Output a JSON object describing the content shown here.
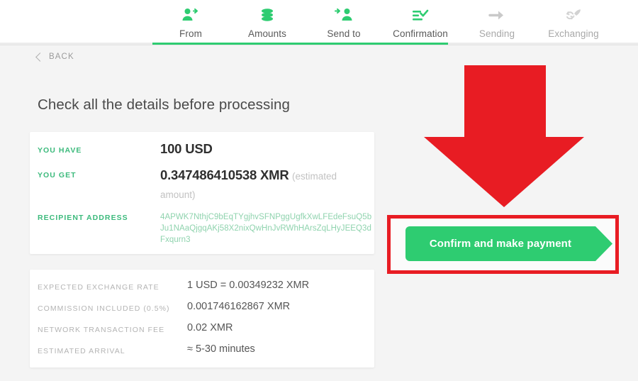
{
  "nav": {
    "steps": [
      {
        "label": "From",
        "icon": "person-arrow-icon",
        "state": "done"
      },
      {
        "label": "Amounts",
        "icon": "coins-stack-icon",
        "state": "done"
      },
      {
        "label": "Send to",
        "icon": "arrow-person-icon",
        "state": "done"
      },
      {
        "label": "Confirmation",
        "icon": "checklist-check-icon",
        "state": "active"
      },
      {
        "label": "Sending",
        "icon": "arrow-right-icon",
        "state": "pending"
      },
      {
        "label": "Exchanging",
        "icon": "exchange-rocket-icon",
        "state": "pending"
      }
    ],
    "progress_percent": 62
  },
  "back": {
    "label": "BACK",
    "icon": "chevron-left-icon"
  },
  "page": {
    "title": "Check all the details before processing"
  },
  "summary": {
    "rows": [
      {
        "label": "YOU HAVE",
        "value": "100 USD"
      },
      {
        "label": "YOU GET",
        "value": "0.347486410538 XMR",
        "suffix": "(estimated amount)"
      },
      {
        "label": "RECIPIENT ADDRESS",
        "value": "4APWK7NthjC9bEqTYgjhvSFNPggUgfkXwLFEdeFsuQ5bJu1NAaQjgqAKj58X2nixQwHnJvRWhHArsZqLHyJEEQ3dFxqurn3"
      }
    ]
  },
  "fees": {
    "rows": [
      {
        "label": "EXPECTED EXCHANGE RATE",
        "value": "1 USD = 0.00349232 XMR"
      },
      {
        "label": "COMMISSION INCLUDED (0.5%)",
        "value": "0.001746162867 XMR"
      },
      {
        "label": "NETWORK TRANSACTION FEE",
        "value": "0.02 XMR"
      },
      {
        "label": "ESTIMATED ARRIVAL",
        "value": "≈ 5-30 minutes"
      }
    ]
  },
  "cta": {
    "label": "Confirm and make payment"
  },
  "annotations": {
    "arrow": "down-arrow-annotation",
    "highlight": "red-highlight-box"
  },
  "colors": {
    "accent_green": "#2ecc71",
    "label_green": "#3cba7c",
    "address_green": "#8fd3ae",
    "annotation_red": "#e81c23",
    "page_bg": "#f4f4f4"
  }
}
